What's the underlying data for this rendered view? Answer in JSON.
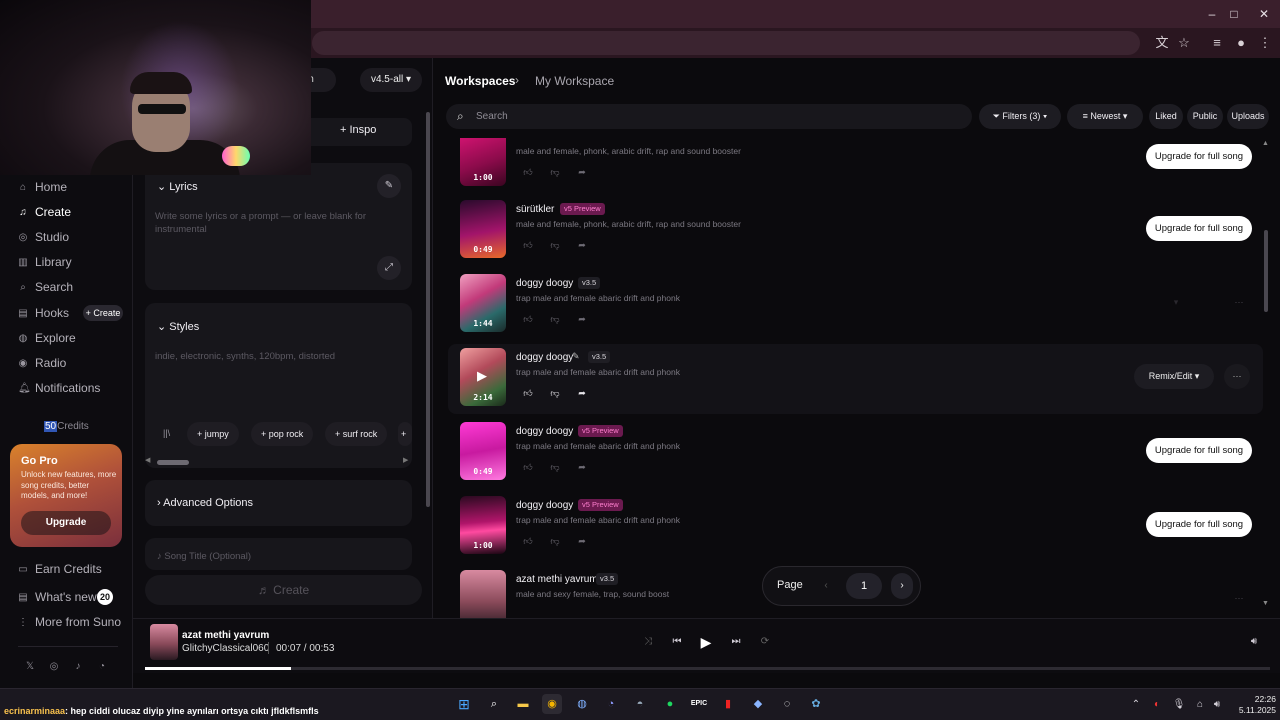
{
  "browser": {
    "window_controls": [
      "–",
      "□",
      "✕"
    ],
    "toolbar_icons": [
      "translate-icon",
      "bookmark-star-icon",
      "media-controls-icon",
      "profile-avatar-icon",
      "kebab-menu-icon"
    ]
  },
  "create_panel": {
    "tab_partial": "om",
    "version": "v4.5-all",
    "inspo_label": "Inspo",
    "lyrics": {
      "title": "Lyrics",
      "placeholder": "Write some lyrics or a prompt — or leave blank for instrumental"
    },
    "styles": {
      "title": "Styles",
      "placeholder": "indie, electronic, synths, 120bpm, distorted",
      "chips": [
        "jumpy",
        "pop rock",
        "surf rock"
      ]
    },
    "advanced_label": "Advanced Options",
    "song_title_placeholder": "Song Title (Optional)",
    "create_button": "Create"
  },
  "sidebar": {
    "items": [
      {
        "label": "Home",
        "icon": "home-icon"
      },
      {
        "label": "Create",
        "icon": "music-note-icon"
      },
      {
        "label": "Studio",
        "icon": "studio-icon"
      },
      {
        "label": "Library",
        "icon": "library-icon"
      },
      {
        "label": "Search",
        "icon": "search-icon"
      },
      {
        "label": "Hooks",
        "icon": "hooks-icon"
      },
      {
        "label": "Explore",
        "icon": "compass-icon"
      },
      {
        "label": "Radio",
        "icon": "radio-icon"
      },
      {
        "label": "Notifications",
        "icon": "bell-icon"
      }
    ],
    "hooks_create": "+ Create",
    "credits_num": "50",
    "credits_label": "Credits",
    "gopro": {
      "title": "Go Pro",
      "text": "Unlock new features, more song credits, better models, and more!",
      "button": "Upgrade"
    },
    "earn_credits": "Earn Credits",
    "whats_new": "What's new?",
    "whats_new_count": "20",
    "more_from": "More from Suno",
    "social_icons": [
      "x-icon",
      "instagram-icon",
      "tiktok-icon",
      "discord-icon"
    ]
  },
  "workspace": {
    "breadcrumb_root": "Workspaces",
    "breadcrumb_current": "My Workspace",
    "search_placeholder": "Search",
    "filters_label": "Filters (3)",
    "sort_label": "Newest",
    "liked_label": "Liked",
    "public_label": "Public",
    "uploads_label": "Uploads"
  },
  "songs": [
    {
      "title": "",
      "version": "",
      "desc": "male and female, phonk, arabic drift, rap and sound booster",
      "duration": "1:00",
      "action": "Upgrade for full song"
    },
    {
      "title": "sürütkler",
      "version": "v5 Preview",
      "desc": "male and female, phonk, arabic drift, rap and sound booster",
      "duration": "0:49",
      "action": "Upgrade for full song"
    },
    {
      "title": "doggy doogy",
      "version": "v3.5",
      "desc": "trap male and female abaric drift and phonk",
      "duration": "1:44",
      "action": ""
    },
    {
      "title": "doggy doogy",
      "version": "v3.5",
      "desc": "trap male and female abaric drift and phonk",
      "duration": "2:14",
      "action": "Remix/Edit"
    },
    {
      "title": "doggy doogy",
      "version": "v5 Preview",
      "desc": "trap male and female abaric drift and phonk",
      "duration": "0:49",
      "action": "Upgrade for full song"
    },
    {
      "title": "doggy doogy",
      "version": "v5 Preview",
      "desc": "trap male and female abaric drift and phonk",
      "duration": "1:00",
      "action": "Upgrade for full song"
    },
    {
      "title": "azat methi yavrum",
      "version": "v3.5",
      "desc": "male and sexy female, trap, sound boost",
      "duration": "",
      "action": ""
    }
  ],
  "pagination": {
    "label": "Page",
    "current": "1"
  },
  "player": {
    "title": "azat methi yavrum",
    "artist": "GlitchyClassical060",
    "time": "00:07 /  00:53",
    "progress_fraction": 0.13
  },
  "taskbar": {
    "chat_user": "ecrinarminaaa",
    "chat_text": ": hep ciddi olucaz diyip yine aynıları ortsya cıktı jfldkflsmfls",
    "clock_time": "22:26",
    "clock_date": "5.11.2025",
    "app_icons": [
      "windows-start-icon",
      "search-icon",
      "file-explorer-icon",
      "chrome-icon",
      "app-icon",
      "discord-icon",
      "steam-icon",
      "spotify-icon",
      "epic-games-icon",
      "app-icon",
      "app-icon",
      "app-icon",
      "app-icon"
    ]
  },
  "colors": {
    "accent_pink": "#ff7fcf",
    "v5_tag_bg": "#6b1a4f",
    "gopro_orange": "#d9822b"
  }
}
